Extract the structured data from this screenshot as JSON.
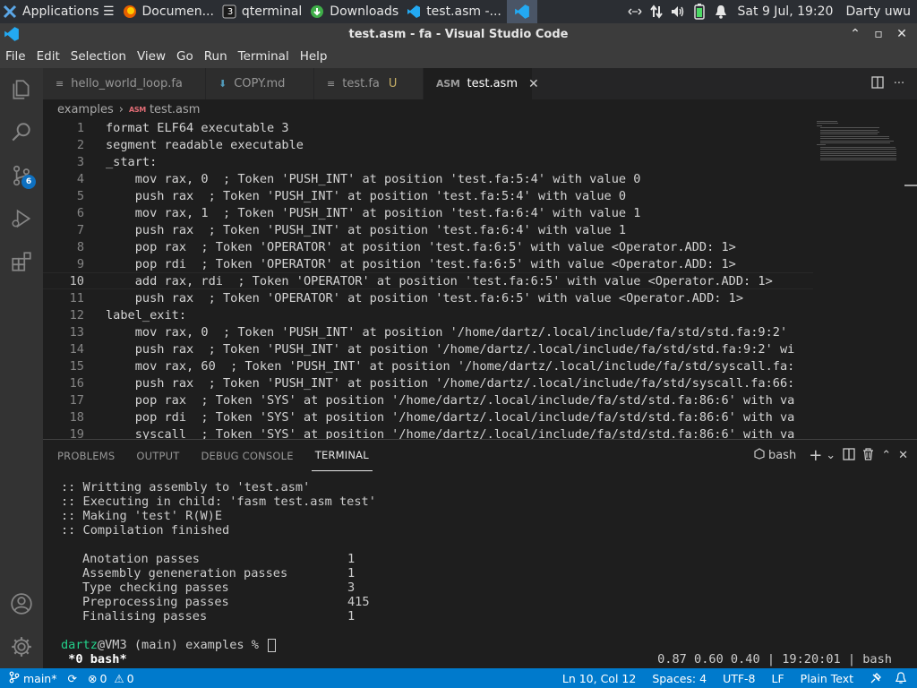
{
  "taskbar": {
    "tasks": [
      {
        "label": "Applications ☰",
        "icon": "xfce-icon",
        "active": false
      },
      {
        "label": "Documen...",
        "icon": "firefox-icon",
        "active": false
      },
      {
        "label": "qterminal",
        "icon": "terminal-icon",
        "active": false
      },
      {
        "label": "Downloads",
        "icon": "downloads-icon",
        "active": false
      },
      {
        "label": "test.asm -...",
        "icon": "vscode-icon",
        "active": false
      },
      {
        "label": "",
        "icon": "vscode-icon",
        "active": true
      }
    ],
    "terminal_count": "3",
    "clock": "Sat  9 Jul, 19:20",
    "user": "Darty uwu"
  },
  "window": {
    "title": "test.asm - fa - Visual Studio Code"
  },
  "menu": [
    "File",
    "Edit",
    "Selection",
    "View",
    "Go",
    "Run",
    "Terminal",
    "Help"
  ],
  "activity": {
    "source_control_badge": "6"
  },
  "tabs": [
    {
      "label": "hello_world_loop.fa",
      "icon": "≡",
      "modified": "",
      "active": false
    },
    {
      "label": "COPY.md",
      "icon": "⬇",
      "modified": "",
      "active": false
    },
    {
      "label": "test.fa",
      "icon": "≡",
      "modified": "U",
      "active": false
    },
    {
      "label": "test.asm",
      "icon": "ASM",
      "modified": "",
      "active": true
    }
  ],
  "breadcrumb": {
    "folder": "examples",
    "file_tag": "ASM",
    "file": "test.asm"
  },
  "editor": {
    "current_line": 10,
    "lines": [
      {
        "n": "1",
        "text": "format ELF64 executable 3"
      },
      {
        "n": "2",
        "text": "segment readable executable"
      },
      {
        "n": "3",
        "text": "_start:"
      },
      {
        "n": "4",
        "text": "    mov rax, 0  ; Token 'PUSH_INT' at position 'test.fa:5:4' with value 0"
      },
      {
        "n": "5",
        "text": "    push rax  ; Token 'PUSH_INT' at position 'test.fa:5:4' with value 0"
      },
      {
        "n": "6",
        "text": "    mov rax, 1  ; Token 'PUSH_INT' at position 'test.fa:6:4' with value 1"
      },
      {
        "n": "7",
        "text": "    push rax  ; Token 'PUSH_INT' at position 'test.fa:6:4' with value 1"
      },
      {
        "n": "8",
        "text": "    pop rax  ; Token 'OPERATOR' at position 'test.fa:6:5' with value <Operator.ADD: 1>"
      },
      {
        "n": "9",
        "text": "    pop rdi  ; Token 'OPERATOR' at position 'test.fa:6:5' with value <Operator.ADD: 1>"
      },
      {
        "n": "10",
        "text": "    add rax, rdi  ; Token 'OPERATOR' at position 'test.fa:6:5' with value <Operator.ADD: 1>"
      },
      {
        "n": "11",
        "text": "    push rax  ; Token 'OPERATOR' at position 'test.fa:6:5' with value <Operator.ADD: 1>"
      },
      {
        "n": "12",
        "text": "label_exit:"
      },
      {
        "n": "13",
        "text": "    mov rax, 0  ; Token 'PUSH_INT' at position '/home/dartz/.local/include/fa/std/std.fa:9:2'"
      },
      {
        "n": "14",
        "text": "    push rax  ; Token 'PUSH_INT' at position '/home/dartz/.local/include/fa/std/std.fa:9:2' wi"
      },
      {
        "n": "15",
        "text": "    mov rax, 60  ; Token 'PUSH_INT' at position '/home/dartz/.local/include/fa/std/syscall.fa:"
      },
      {
        "n": "16",
        "text": "    push rax  ; Token 'PUSH_INT' at position '/home/dartz/.local/include/fa/std/syscall.fa:66:"
      },
      {
        "n": "17",
        "text": "    pop rax  ; Token 'SYS' at position '/home/dartz/.local/include/fa/std/std.fa:86:6' with va"
      },
      {
        "n": "18",
        "text": "    pop rdi  ; Token 'SYS' at position '/home/dartz/.local/include/fa/std/std.fa:86:6' with va"
      },
      {
        "n": "19",
        "text": "    syscall  ; Token 'SYS' at position '/home/dartz/.local/include/fa/std/std.fa:86:6' with va"
      }
    ]
  },
  "panel": {
    "tabs": [
      "PROBLEMS",
      "OUTPUT",
      "DEBUG CONSOLE",
      "TERMINAL"
    ],
    "active_tab": "TERMINAL",
    "shell": "bash"
  },
  "terminal": {
    "log": [
      ":: Writting assembly to 'test.asm'",
      ":: Executing in child: 'fasm test.asm test'",
      ":: Making 'test' R(W)E",
      ":: Compilation finished"
    ],
    "stats": [
      {
        "label": "Anotation passes",
        "value": "1"
      },
      {
        "label": "Assembly geneneration passes",
        "value": "1"
      },
      {
        "label": "Type checking passes",
        "value": "3"
      },
      {
        "label": "Preprocessing passes",
        "value": "415"
      },
      {
        "label": "Finalising passes",
        "value": "1"
      }
    ],
    "prompt_user": "dartz",
    "prompt_rest": "@VM3 (main) examples % ",
    "tmux_window": " *0 bash*",
    "tmux_status": "0.87 0.60 0.40 | 19:20:01 | bash"
  },
  "statusbar": {
    "branch": "main*",
    "errors": "0",
    "warnings": "0",
    "position": "Ln 10, Col 12",
    "indent": "Spaces: 4",
    "encoding": "UTF-8",
    "eol": "LF",
    "language": "Plain Text"
  },
  "colors": {
    "accent": "#007acc",
    "prompt_user": "#23d18b",
    "asm_icon": "#e06c75"
  }
}
